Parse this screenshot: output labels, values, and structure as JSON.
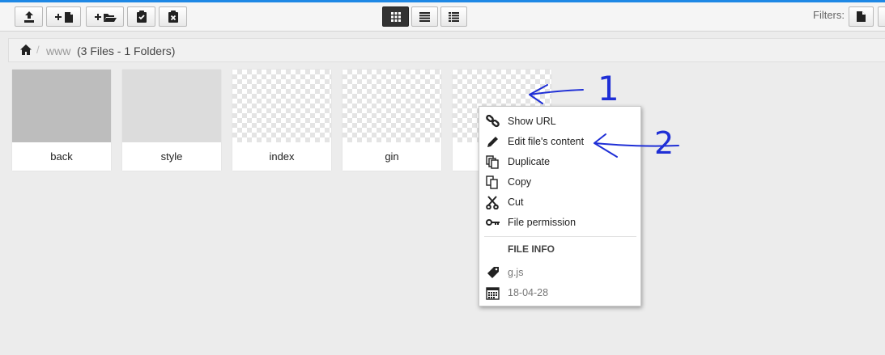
{
  "toolbar": {
    "left_buttons": [
      {
        "icon": "upload-icon"
      },
      {
        "icon": "new-file-icon"
      },
      {
        "icon": "new-folder-icon"
      },
      {
        "icon": "clipboard-paste-icon"
      },
      {
        "icon": "clipboard-clear-icon"
      }
    ],
    "view_buttons": [
      {
        "icon": "grid-view-icon",
        "active": true
      },
      {
        "icon": "list-view-icon",
        "active": false
      },
      {
        "icon": "columns-view-icon",
        "active": false
      }
    ],
    "filters_label": "Filters:"
  },
  "breadcrumb": {
    "home_icon": "home-icon",
    "separator": "/",
    "folder": "www",
    "stats": "(3 Files - 1 Folders)"
  },
  "tiles": [
    {
      "name": "back",
      "thumb": "gray-dark"
    },
    {
      "name": "style",
      "thumb": "gray-light"
    },
    {
      "name": "index",
      "thumb": "transparent"
    },
    {
      "name": "gin",
      "thumb": "transparent"
    },
    {
      "name": "",
      "thumb": "transparent"
    }
  ],
  "context_menu": {
    "items": [
      {
        "label": "Show URL",
        "icon": "link-icon"
      },
      {
        "label": "Edit file's content",
        "icon": "pencil-icon"
      },
      {
        "label": "Duplicate",
        "icon": "duplicate-icon"
      },
      {
        "label": "Copy",
        "icon": "copy-icon"
      },
      {
        "label": "Cut",
        "icon": "scissors-icon"
      },
      {
        "label": "File permission",
        "icon": "key-icon"
      }
    ],
    "info_header": "FILE INFO",
    "info": [
      {
        "label": "g.js",
        "icon": "tag-icon"
      },
      {
        "label": "18-04-28",
        "icon": "calendar-icon"
      }
    ]
  },
  "annotations": {
    "first": "1",
    "second": "2",
    "color": "#1f2fd6"
  },
  "colors": {
    "accent": "#1e88e5",
    "active_view": "#333333"
  }
}
